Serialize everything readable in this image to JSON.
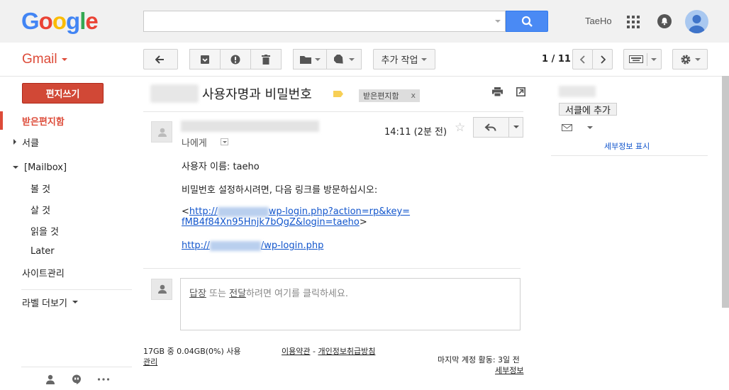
{
  "header": {
    "logo": {
      "letters": [
        "G",
        "o",
        "o",
        "g",
        "l",
        "e"
      ],
      "colors": [
        "#4285F4",
        "#EA4335",
        "#FBBC05",
        "#4285F4",
        "#34A853",
        "#EA4335"
      ]
    },
    "search_value": "",
    "user_name": "TaeHo"
  },
  "toolbar": {
    "gmail_label": "Gmail",
    "more_actions_label": "추가 작업",
    "pager": "1 / 11"
  },
  "sidebar": {
    "compose_label": "편지쓰기",
    "items": [
      {
        "label": "받은편지함",
        "active": true
      },
      {
        "label": "서클"
      },
      {
        "label": "[Mailbox]"
      },
      {
        "label": "볼 것"
      },
      {
        "label": "살 것"
      },
      {
        "label": "읽을 것"
      },
      {
        "label": "Later"
      },
      {
        "label": "사이트관리"
      }
    ],
    "more_labels": "라벨 더보기"
  },
  "thread": {
    "subject": "사용자명과 비밀번호",
    "inbox_chip": "받은편지함",
    "chip_close": "x"
  },
  "message": {
    "to_me": "나에게",
    "time": "14:11 (2분 전)",
    "username_line": "사용자 이름: taeho",
    "instruction_line": "비밀번호 설정하시려면, 다음 링크를 방문하십시오:",
    "link1_prefix": "<",
    "link1_a": "http://",
    "link1_b": "wp-login.php?action=rp&key=",
    "link1_c": "fMB4f84Xn95Hnjk7bQgZ&login=taeho",
    "link1_suffix": ">",
    "link2_a": "http://",
    "link2_b": "/wp-login.php"
  },
  "reply": {
    "reply_word": "답장",
    "or_word": " 또는 ",
    "forward_word": "전달",
    "tail": "하려면 여기를 클릭하세요."
  },
  "footer": {
    "storage": "17GB 중 0.04GB(0%) 사용",
    "manage": "관리",
    "terms": "이용약관",
    "dash": " - ",
    "privacy": "개인정보취급방침",
    "last_activity": "마지막 계정 활동: 3일 전",
    "details": "세부정보"
  },
  "contact": {
    "add_to_circles": "서클에 추가",
    "show_details": "세부정보 표시"
  }
}
